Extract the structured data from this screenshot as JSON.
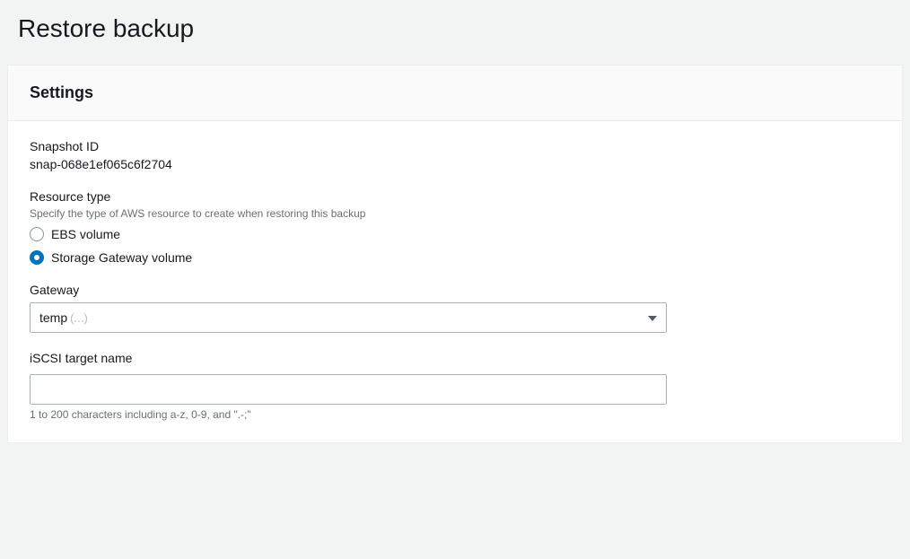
{
  "page": {
    "title": "Restore backup"
  },
  "panel": {
    "heading": "Settings"
  },
  "snapshot": {
    "label": "Snapshot ID",
    "value": "snap-068e1ef065c6f2704"
  },
  "resource_type": {
    "label": "Resource type",
    "description": "Specify the type of AWS resource to create when restoring this backup",
    "options": {
      "ebs": "EBS volume",
      "sgw": "Storage Gateway volume"
    },
    "selected": "sgw"
  },
  "gateway": {
    "label": "Gateway",
    "value_prefix": "temp",
    "value_suffix": "(…)"
  },
  "iscsi": {
    "label": "iSCSI target name",
    "value": "",
    "hint": "1 to 200 characters including a-z, 0-9, and \".-;\""
  }
}
